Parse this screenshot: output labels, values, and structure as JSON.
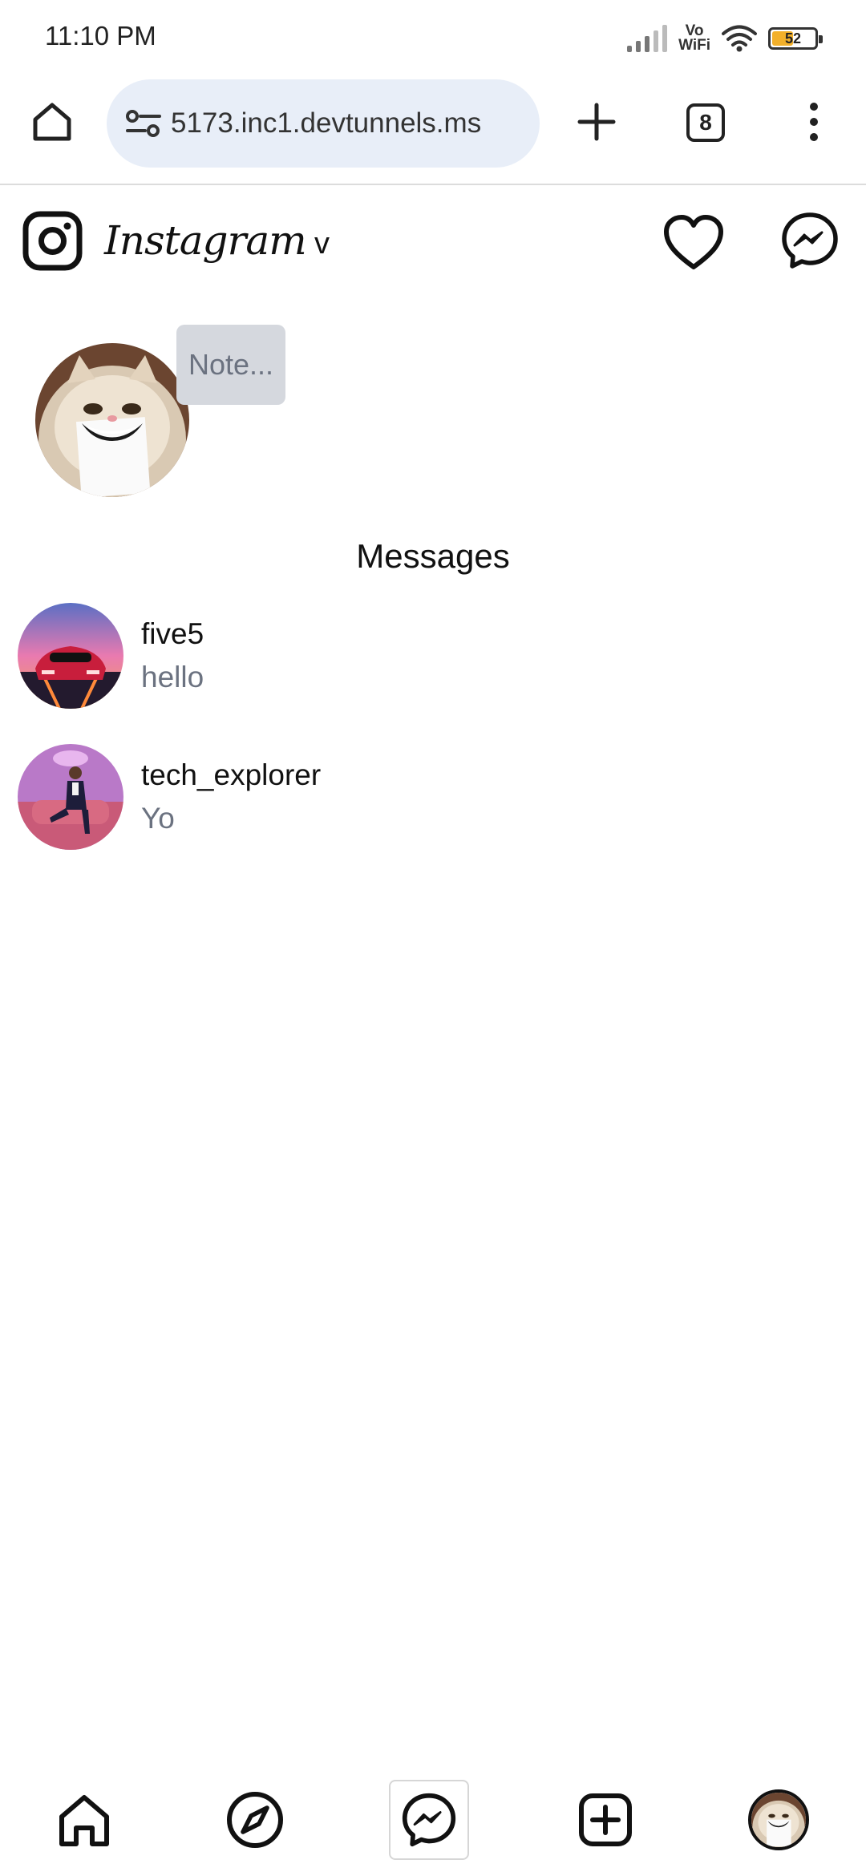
{
  "status_bar": {
    "time": "11:10 PM",
    "vowifi_top": "Vo",
    "vowifi_bottom": "WiFi",
    "battery": "52",
    "battery_level_percent": 52
  },
  "browser": {
    "url": "5173.inc1.devtunnels.ms",
    "tab_count": "8"
  },
  "header": {
    "wordmark": "Instagram",
    "switcher": "v"
  },
  "notes": {
    "placeholder": "Note..."
  },
  "messages": {
    "heading": "Messages",
    "conversations": [
      {
        "username": "five5",
        "preview": "hello"
      },
      {
        "username": "tech_explorer",
        "preview": "Yo"
      }
    ]
  },
  "bottom_nav": {
    "active": "messages"
  },
  "icons": {
    "home": "home-icon",
    "site_settings": "tune-icon",
    "new_tab": "plus-icon",
    "menu": "more-vertical-icon",
    "logo": "instagram-logo-icon",
    "notifications": "heart-icon",
    "messenger": "messenger-icon",
    "explore": "compass-icon",
    "create": "plus-square-icon"
  },
  "colors": {
    "url_pill": "#e8eef8",
    "note_bubble": "#d5d8de",
    "secondary_text": "#6b7280",
    "battery_fill": "#f2b02b"
  }
}
